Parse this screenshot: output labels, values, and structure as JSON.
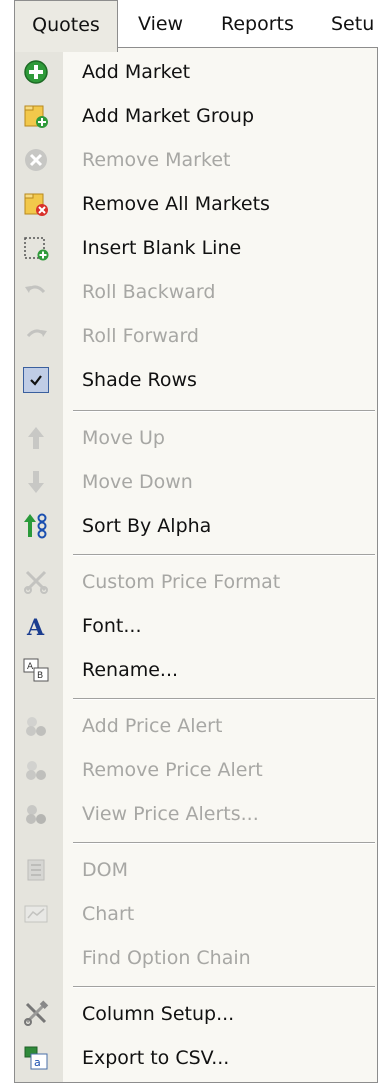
{
  "menubar": {
    "items": [
      {
        "label": "Quotes",
        "active": true
      },
      {
        "label": "View"
      },
      {
        "label": "Reports"
      },
      {
        "label": "Setu"
      }
    ]
  },
  "menu": {
    "items": [
      {
        "label": "Add Market",
        "icon": "add-circle-icon",
        "enabled": true
      },
      {
        "label": "Add Market Group",
        "icon": "folder-add-icon",
        "enabled": true
      },
      {
        "label": "Remove Market",
        "icon": "remove-circle-icon",
        "enabled": false
      },
      {
        "label": "Remove All Markets",
        "icon": "folder-remove-icon",
        "enabled": true
      },
      {
        "label": "Insert Blank Line",
        "icon": "insert-line-icon",
        "enabled": true
      },
      {
        "label": "Roll Backward",
        "icon": "undo-arrow-icon",
        "enabled": false
      },
      {
        "label": "Roll Forward",
        "icon": "redo-arrow-icon",
        "enabled": false
      },
      {
        "label": "Shade Rows",
        "icon": "checkmark-icon",
        "enabled": true,
        "checked": true
      },
      {
        "label": "Move Up",
        "icon": "arrow-up-icon",
        "enabled": false
      },
      {
        "label": "Move Down",
        "icon": "arrow-down-icon",
        "enabled": false
      },
      {
        "label": "Sort By Alpha",
        "icon": "sort-icon",
        "enabled": true
      },
      {
        "label": "Custom Price Format",
        "icon": "scissors-icon",
        "enabled": false
      },
      {
        "label": "Font...",
        "icon": "font-icon",
        "enabled": true
      },
      {
        "label": "Rename...",
        "icon": "rename-icon",
        "enabled": true
      },
      {
        "label": "Add Price Alert",
        "icon": "alert-add-icon",
        "enabled": false
      },
      {
        "label": "Remove Price Alert",
        "icon": "alert-remove-icon",
        "enabled": false
      },
      {
        "label": "View Price Alerts...",
        "icon": "alert-view-icon",
        "enabled": false
      },
      {
        "label": "DOM",
        "icon": "dom-icon",
        "enabled": false
      },
      {
        "label": "Chart",
        "icon": "chart-icon",
        "enabled": false
      },
      {
        "label": "Find Option Chain",
        "icon": "",
        "enabled": false
      },
      {
        "label": "Column Setup...",
        "icon": "tools-icon",
        "enabled": true
      },
      {
        "label": "Export to CSV...",
        "icon": "csv-export-icon",
        "enabled": true
      }
    ]
  }
}
